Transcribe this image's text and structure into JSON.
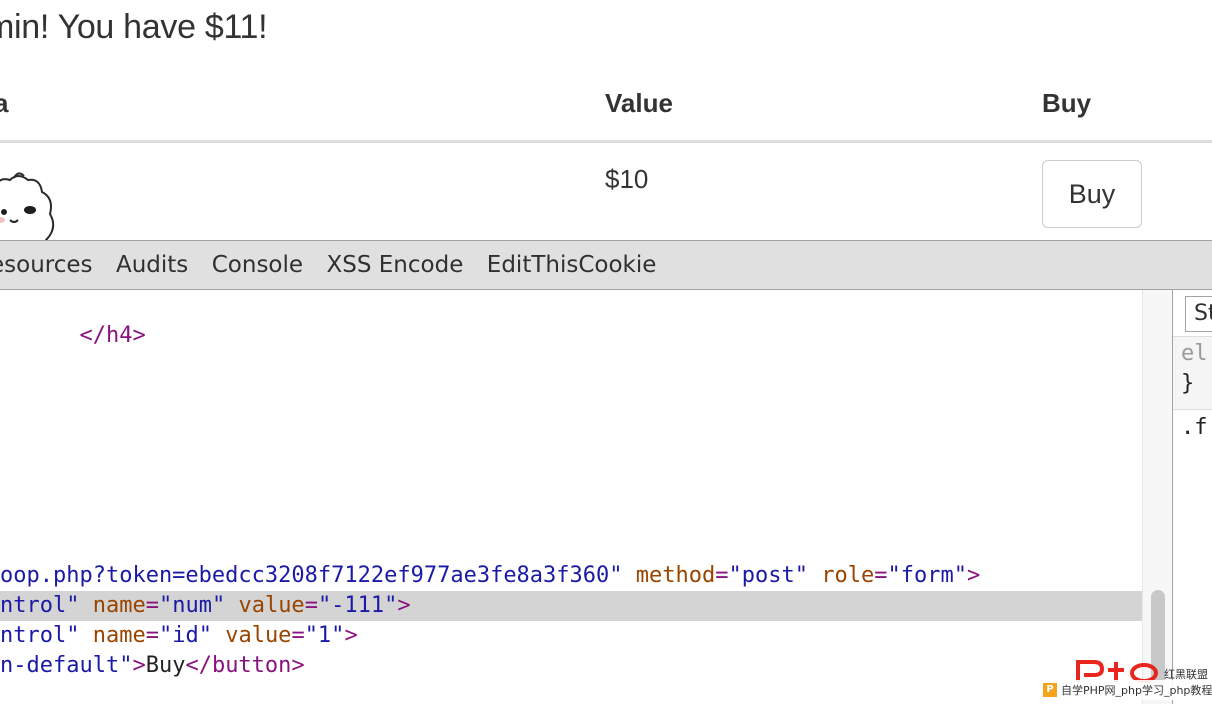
{
  "page": {
    "greeting": "min! You have $11!",
    "table": {
      "headers": [
        "a",
        "Value",
        "Buy"
      ],
      "row": {
        "value": "$10",
        "buy_label": "Buy"
      }
    }
  },
  "devtools": {
    "tabs": [
      "esources",
      "Audits",
      "Console",
      "XSS Encode",
      "EditThisCookie"
    ],
    "code": {
      "line1_close_h4": "</h4>",
      "line2": {
        "val_tail": "oop.php?token=ebedcc3208f7122ef977ae3fe8a3f360\"",
        "attr_method": "method",
        "val_method": "\"post\"",
        "attr_role": "role",
        "val_role": "\"form\""
      },
      "line3": {
        "val_tail": "ntrol\"",
        "attr_name": "name",
        "val_name": "\"num\"",
        "attr_value": "value",
        "val_value": "\"-111\""
      },
      "line4": {
        "val_tail": "ntrol\"",
        "attr_name": "name",
        "val_name": "\"id\"",
        "attr_value": "value",
        "val_value": "\"1\""
      },
      "line5": {
        "val_tail": "n-default\"",
        "text": "Buy",
        "close_tag": "</button>"
      }
    },
    "side_panel": {
      "tab_label": "St",
      "line1": "el",
      "line2": "}",
      "line3": ".f"
    }
  },
  "watermark": {
    "brand": "红黑联盟",
    "text": "自学PHP网_php学习_php教程",
    "icon": "P",
    "colors": {
      "logo_red": "#e8261d",
      "icon_orange": "#f7a21b"
    }
  }
}
